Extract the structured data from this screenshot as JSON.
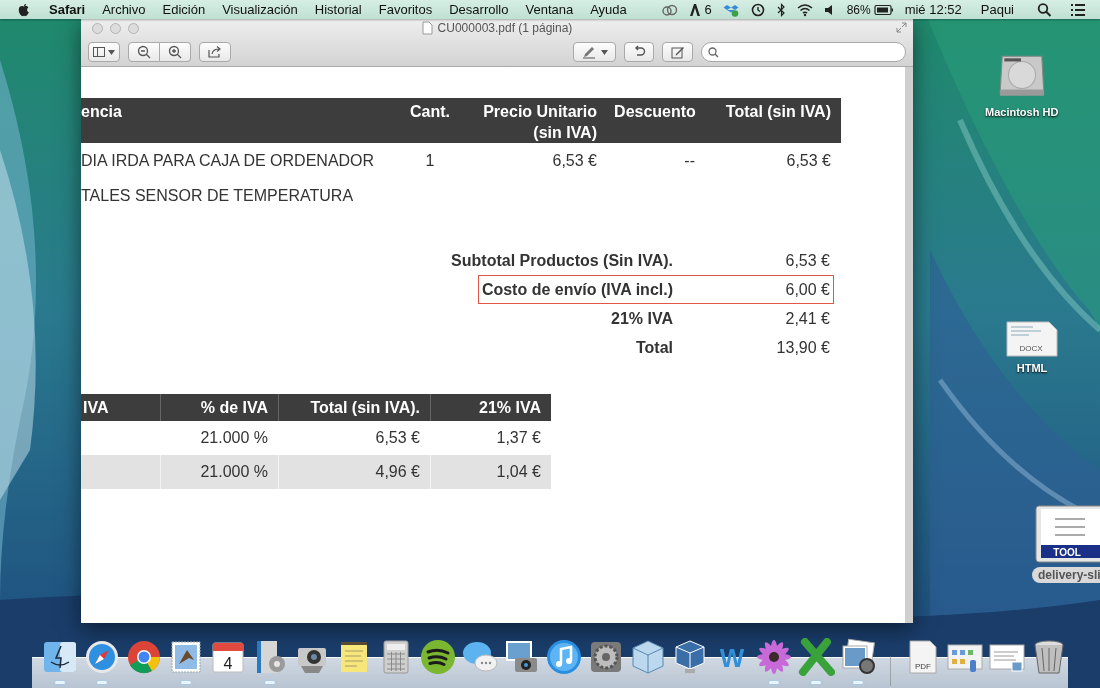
{
  "menu_bar": {
    "app_name": "Safari",
    "menus": [
      "Archivo",
      "Edición",
      "Visualización",
      "Historial",
      "Favoritos",
      "Desarrollo",
      "Ventana",
      "Ayuda"
    ],
    "adobe_count": "6",
    "battery": "86%",
    "clock": "mié 12:52",
    "user": "Paqui"
  },
  "window": {
    "title": "CU000003.pdf (1 página)"
  },
  "document": {
    "items_table": {
      "columns": [
        "encia",
        "Cant.",
        "Precio Unitario (sin IVA)",
        "Descuento",
        "Total (sin IVA)"
      ],
      "rows": [
        [
          "DIA IRDA PARA CAJA DE ORDENADOR",
          "1",
          "6,53 €",
          "--",
          "6,53 €"
        ],
        [
          "TALES SENSOR DE TEMPERATURA"
        ]
      ]
    },
    "totals": [
      {
        "label": "Subtotal Productos (Sin IVA).",
        "value": "6,53 €",
        "highlighted": false
      },
      {
        "label": "Costo de envío (IVA incl.)",
        "value": "6,00 €",
        "highlighted": true
      },
      {
        "label": "21% IVA",
        "value": "2,41 €",
        "highlighted": false
      },
      {
        "label": "Total",
        "value": "13,90 €",
        "highlighted": false
      }
    ],
    "tax_table": {
      "columns": [
        "IVA",
        "% de IVA",
        "Total (sin IVA).",
        "21% IVA"
      ],
      "rows": [
        {
          "cells": [
            "",
            "21.000 %",
            "6,53 €",
            "1,37 €"
          ],
          "shaded": false
        },
        {
          "cells": [
            "",
            "21.000 %",
            "4,96 €",
            "1,04 €"
          ],
          "shaded": true
        }
      ]
    }
  },
  "desktop_icons": [
    {
      "kind": "drive",
      "label": "Macintosh HD"
    },
    {
      "kind": "document",
      "badge": "DOCX",
      "label": "HTML"
    },
    {
      "kind": "tool",
      "badge": "TOOL",
      "label": "delivery-sli"
    }
  ],
  "dock": [
    {
      "kind": "finder",
      "running": true
    },
    {
      "kind": "safari",
      "running": true
    },
    {
      "kind": "chrome",
      "running": false
    },
    {
      "kind": "mail",
      "running": true
    },
    {
      "kind": "calendar",
      "badge": "4",
      "running": false
    },
    {
      "kind": "installer",
      "running": true
    },
    {
      "kind": "camera",
      "running": false
    },
    {
      "kind": "notes",
      "running": false
    },
    {
      "kind": "calculator",
      "running": false
    },
    {
      "kind": "spotify",
      "running": false
    },
    {
      "kind": "messages",
      "running": false
    },
    {
      "kind": "photo_booth",
      "running": false
    },
    {
      "kind": "itunes",
      "running": false
    },
    {
      "kind": "preferences",
      "running": false
    },
    {
      "kind": "cube",
      "running": false
    },
    {
      "kind": "virtualbox",
      "running": false
    },
    {
      "kind": "writer",
      "badge": "W",
      "running": false
    },
    {
      "kind": "flower",
      "running": true
    },
    {
      "kind": "cross",
      "running": true
    },
    {
      "kind": "preview",
      "running": true
    },
    {
      "kind": "separator"
    },
    {
      "kind": "pdf",
      "badge": "PDF",
      "running": false
    },
    {
      "kind": "folder_window",
      "running": false
    },
    {
      "kind": "doc_window",
      "running": false
    },
    {
      "kind": "trash",
      "running": false
    }
  ]
}
